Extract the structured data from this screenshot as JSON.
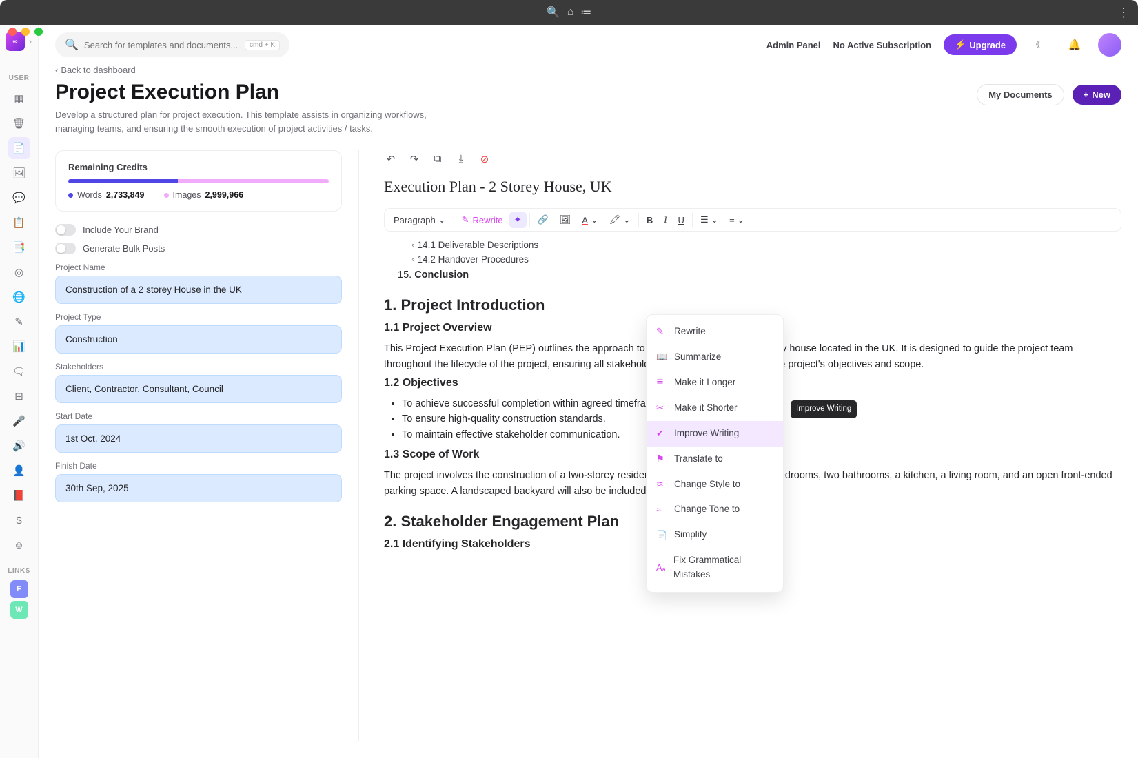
{
  "chrome": {
    "dots": "⋮"
  },
  "rail": {
    "section_user": "USER",
    "section_links": "LINKS",
    "link_f": "F",
    "link_w": "W"
  },
  "header": {
    "search_placeholder": "Search for templates and documents...",
    "shortcut": "cmd + K",
    "admin": "Admin Panel",
    "subscription": "No Active Subscription",
    "upgrade": "Upgrade"
  },
  "page": {
    "back": "Back to dashboard",
    "title": "Project Execution Plan",
    "desc": "Develop a structured plan for project execution. This template assists in organizing workflows, managing teams, and ensuring the smooth execution of project activities / tasks.",
    "my_docs": "My Documents",
    "new": "New"
  },
  "credits": {
    "title": "Remaining Credits",
    "words_label": "Words",
    "words_val": "2,733,849",
    "images_label": "Images",
    "images_val": "2,999,966"
  },
  "toggles": {
    "brand": "Include Your Brand",
    "bulk": "Generate Bulk Posts"
  },
  "form": {
    "project_name_label": "Project Name",
    "project_name": "Construction of a 2 storey House in the UK",
    "project_type_label": "Project Type",
    "project_type": "Construction",
    "stakeholders_label": "Stakeholders",
    "stakeholders": "Client, Contractor, Consultant, Council",
    "start_date_label": "Start Date",
    "start_date": "1st Oct, 2024",
    "finish_date_label": "Finish Date",
    "finish_date": "30th Sep, 2025"
  },
  "doc": {
    "title": "Execution Plan - 2 Storey House, UK",
    "para_select": "Paragraph",
    "rewrite": "Rewrite",
    "toc_141": "14.1 Deliverable Descriptions",
    "toc_142": "14.2 Handover Procedures",
    "toc_15": "15.",
    "toc_15b": "Conclusion",
    "h1": "1. Project Introduction",
    "h11": "1.1 Project Overview",
    "p11": "This Project Execution Plan (PEP) outlines the approach to the construction of a two-storey house located in the UK. It is designed to guide the project team throughout the lifecycle of the project, ensuring all stakeholders' expectations align with the project's objectives and scope.",
    "h12": "1.2 Objectives",
    "obj1": "To achieve successful completion within agreed timeframes and budget.",
    "obj2": "To ensure high-quality construction standards.",
    "obj3": "To maintain effective stakeholder communication.",
    "h13": "1.3 Scope of Work",
    "p13": "The project involves the construction of a two-storey residential building comprising four bedrooms, two bathrooms, a kitchen, a living room, and an open front-ended parking space. A landscaped backyard will also be included.",
    "h2": "2. Stakeholder Engagement Plan",
    "h21": "2.1 Identifying Stakeholders"
  },
  "ai_menu": {
    "rewrite": "Rewrite",
    "summarize": "Summarize",
    "longer": "Make it Longer",
    "shorter": "Make it Shorter",
    "improve": "Improve Writing",
    "translate": "Translate to",
    "style": "Change Style to",
    "tone": "Change Tone to",
    "simplify": "Simplify",
    "grammar": "Fix Grammatical Mistakes"
  },
  "tooltip": "Improve Writing"
}
